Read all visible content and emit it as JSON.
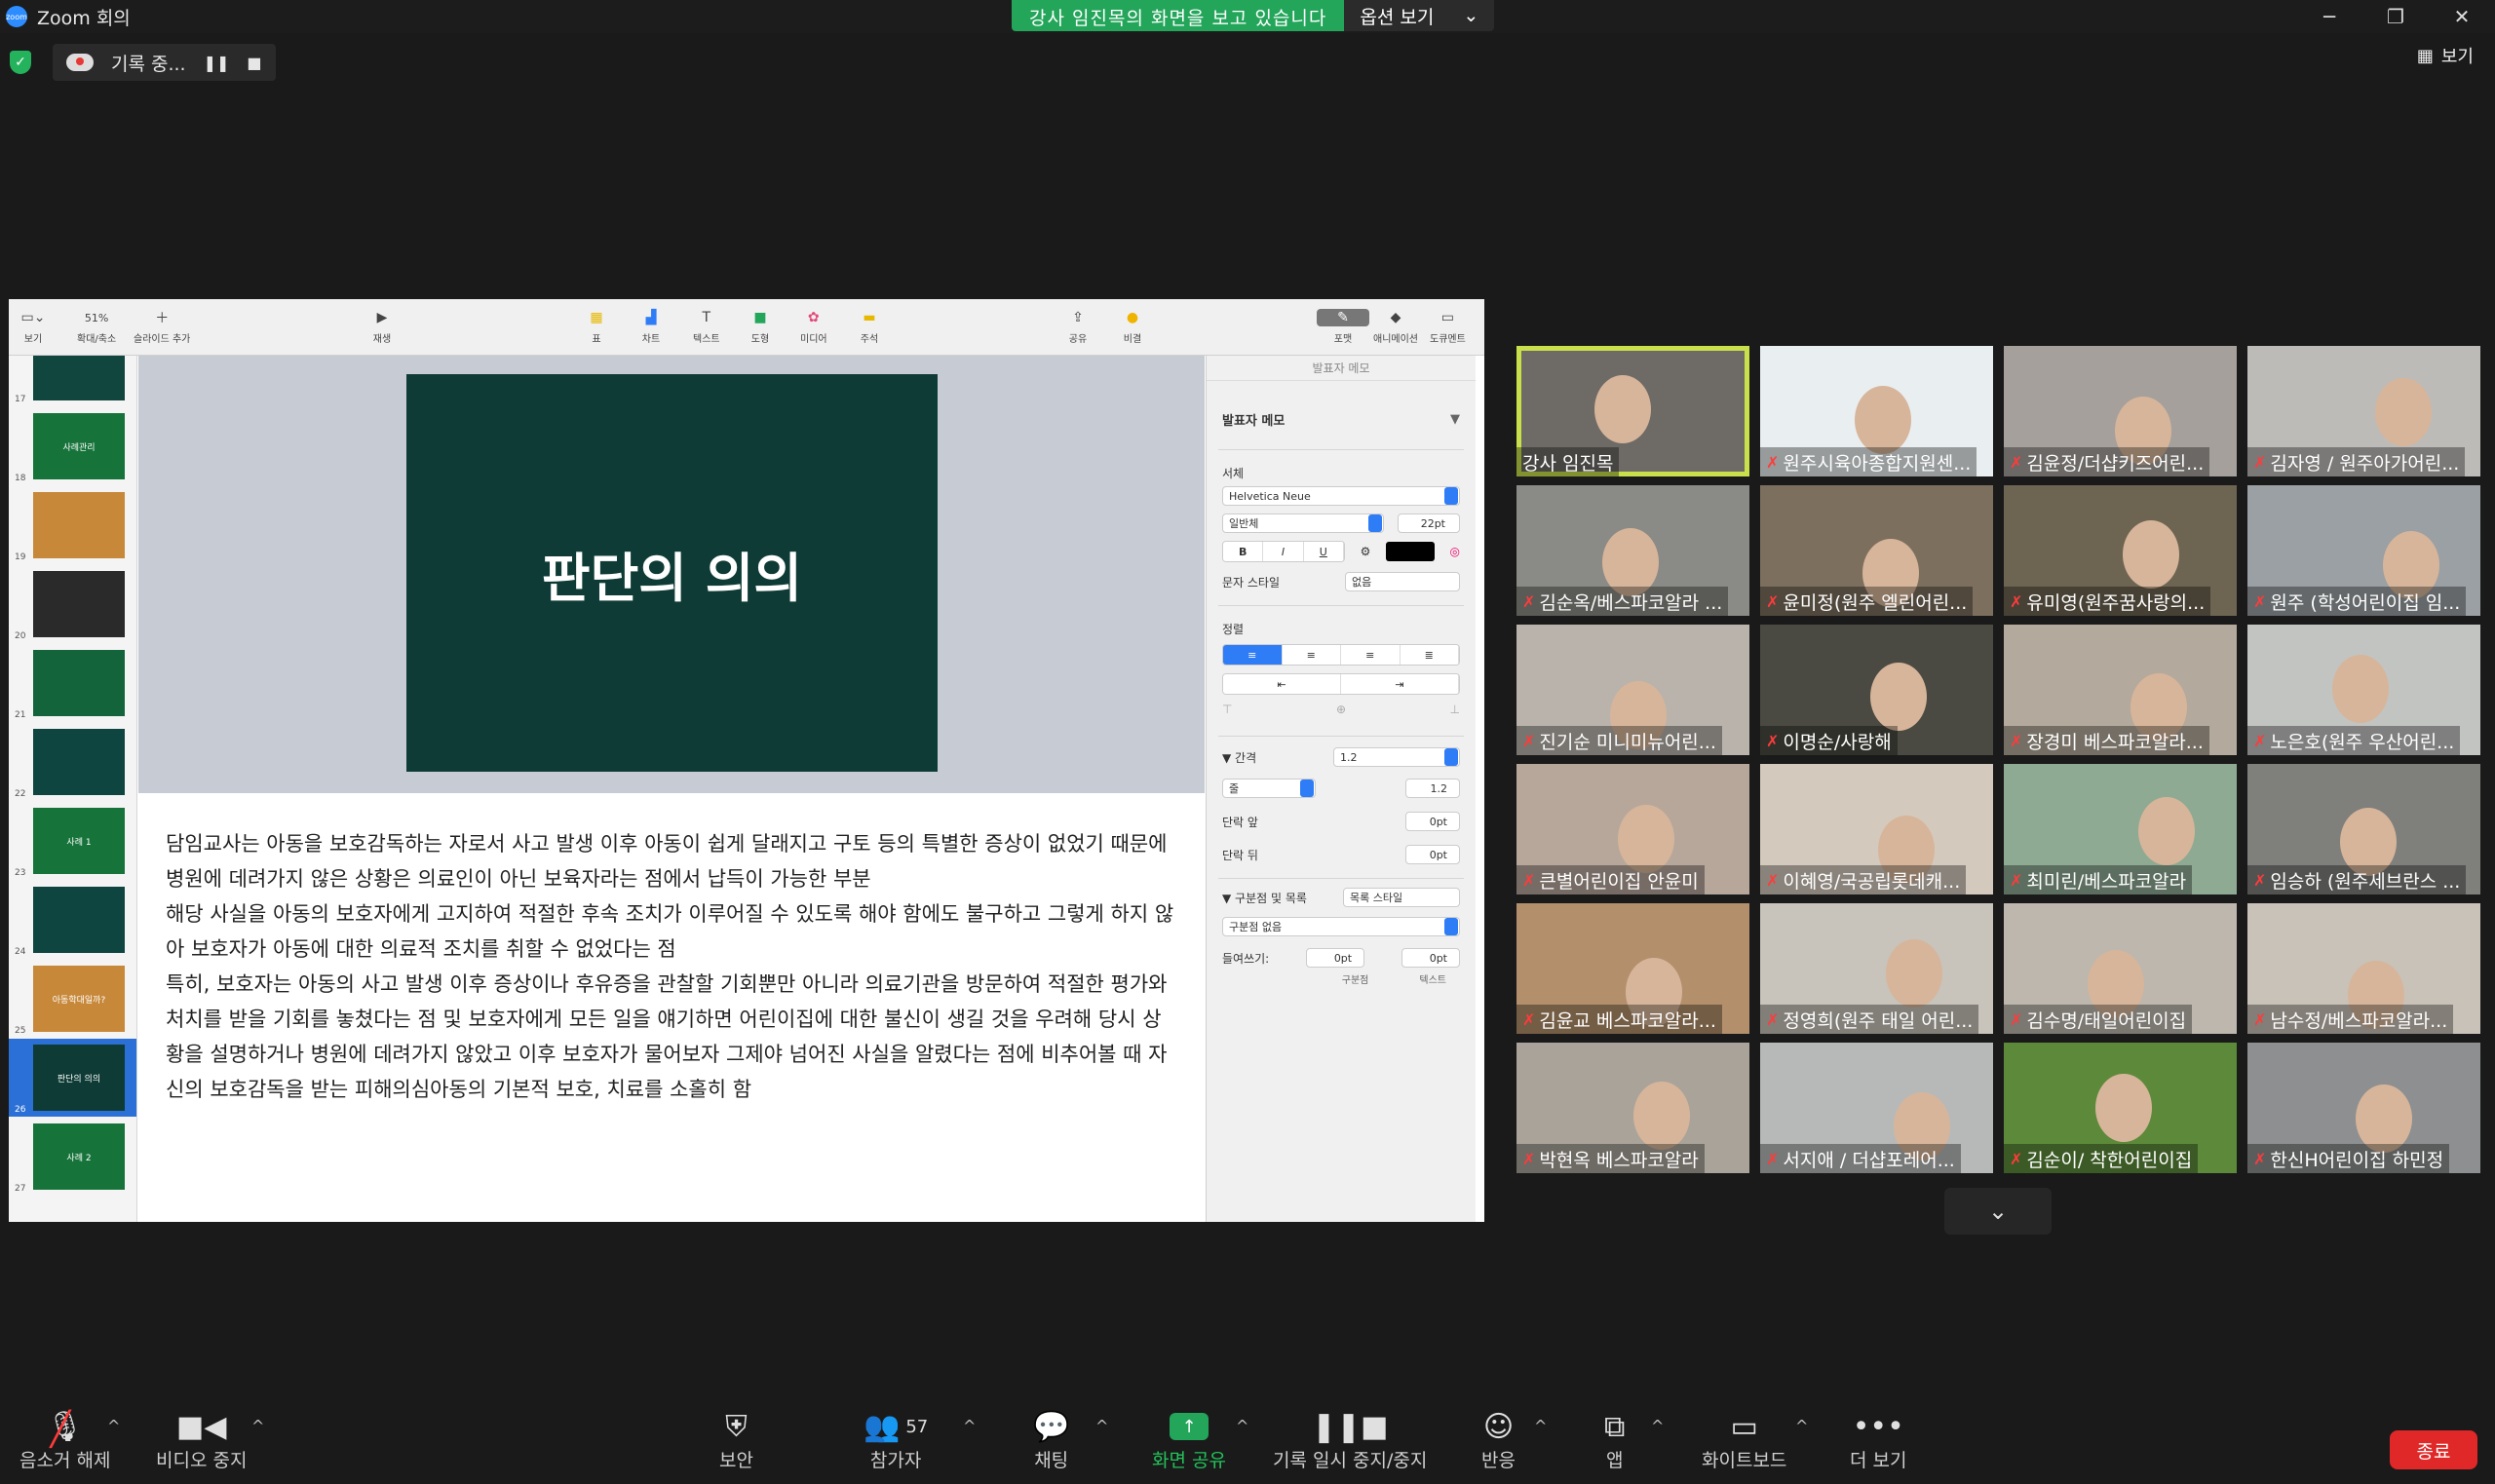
{
  "window": {
    "title": "Zoom 회의",
    "logo": "zoom"
  },
  "share_banner": {
    "text": "강사 임진목의 화면을 보고 있습니다",
    "options_label": "옵션 보기"
  },
  "recording": {
    "label": "기록 중..."
  },
  "top_right": {
    "view_label": "보기"
  },
  "keynote": {
    "toolbar": {
      "view": "보기",
      "zoom_value": "51%",
      "zoom": "확대/축소",
      "add_slide": "슬라이드 추가",
      "play": "재생",
      "table": "표",
      "chart": "차트",
      "text": "텍스트",
      "shape": "도형",
      "media": "미디어",
      "comment": "주석",
      "share": "공유",
      "tips": "비결",
      "format": "포맷",
      "animate": "애니메이션",
      "document": "도큐멘트"
    },
    "navigator": [
      {
        "num": "17",
        "title": "",
        "color": "#10463e"
      },
      {
        "num": "18",
        "title": "사례관리",
        "color": "#16733a"
      },
      {
        "num": "19",
        "title": "",
        "color": "#c7883a"
      },
      {
        "num": "20",
        "title": "",
        "color": "#2a2a2a"
      },
      {
        "num": "21",
        "title": "",
        "color": "#13643a"
      },
      {
        "num": "22",
        "title": "",
        "color": "#0f4540"
      },
      {
        "num": "23",
        "title": "사례 1",
        "color": "#16733a"
      },
      {
        "num": "24",
        "title": "",
        "color": "#0f4540"
      },
      {
        "num": "25",
        "title": "아동학대일까?",
        "color": "#c7883a"
      },
      {
        "num": "26",
        "title": "판단의 의의",
        "color": "#0e3b35"
      },
      {
        "num": "27",
        "title": "사례 2",
        "color": "#16733a"
      }
    ],
    "slide_title": "판단의 의의",
    "notes": [
      "담임교사는 아동을 보호감독하는 자로서 사고 발생 이후 아동이 쉽게 달래지고 구토 등의 특별한 증상이 없었기 때문에 병원에 데려가지 않은 상황은 의료인이 아닌 보육자라는 점에서 납득이 가능한 부분",
      "해당 사실을 아동의 보호자에게 고지하여 적절한 후속 조치가 이루어질 수 있도록 해야 함에도 불구하고 그렇게 하지 않아 보호자가 아동에 대한 의료적 조치를 취할 수 없었다는 점",
      "특히, 보호자는 아동의 사고 발생 이후 증상이나 후유증을 관찰할 기회뿐만 아니라 의료기관을 방문하여 적절한 평가와 처치를 받을 기회를 놓쳤다는 점 및 보호자에게 모든 일을 얘기하면 어린이집에 대한 불신이 생길 것을 우려해 당시 상황을 설명하거나 병원에 데려가지 않았고 이후 보호자가 물어보자 그제야 넘어진 사실을 알렸다는 점에 비추어볼 때 자신의 보호감독을 받는 피해의심아동의 기본적 보호, 치료를 소홀히 함"
    ],
    "inspector": {
      "tab": "발표자 메모",
      "style_title": "발표자 메모",
      "font_label": "서체",
      "font_name": "Helvetica Neue",
      "font_style": "일반체",
      "font_size": "22pt",
      "bold": "B",
      "italic": "I",
      "underline": "U",
      "char_style_label": "문자 스타일",
      "char_style_value": "없음",
      "align_label": "정렬",
      "spacing_label": "간격",
      "spacing_value": "1.2",
      "spacing_mode": "줄",
      "spacing_num": "1.2",
      "before_label": "단락 앞",
      "before_value": "0pt",
      "after_label": "단락 뒤",
      "after_value": "0pt",
      "bullets_label": "구분점 및 목록",
      "bullets_style": "목록 스타일",
      "bullets_value": "구분점 없음",
      "indent_label": "들여쓰기:",
      "indent_bullet": "0pt",
      "indent_text": "0pt",
      "indent_bullet_label": "구분점",
      "indent_text_label": "텍스트"
    }
  },
  "participants": [
    {
      "name": "강사 임진목",
      "muted": false,
      "bg": "#6e6a66",
      "active": true
    },
    {
      "name": "원주시육아종합지원센...",
      "muted": true,
      "bg": "#e9eef0"
    },
    {
      "name": "김윤정/더샵키즈어린...",
      "muted": true,
      "bg": "#a5a09b"
    },
    {
      "name": "김자영 / 원주아가어린...",
      "muted": true,
      "bg": "#bdbbb8"
    },
    {
      "name": "김순옥/베스파코알라 ...",
      "muted": true,
      "bg": "#8a8a86"
    },
    {
      "name": "윤미정(원주 엘린어린...",
      "muted": true,
      "bg": "#7c6f5e"
    },
    {
      "name": "유미영(원주꿈사랑의...",
      "muted": true,
      "bg": "#6d6552"
    },
    {
      "name": "원주 (학성어린이집 임...",
      "muted": true,
      "bg": "#9aa0a3"
    },
    {
      "name": "진기순 미니미뉴어린...",
      "muted": true,
      "bg": "#b9b3ab"
    },
    {
      "name": "이명순/사랑해",
      "muted": true,
      "bg": "#4a4a42"
    },
    {
      "name": "장경미 베스파코알라...",
      "muted": true,
      "bg": "#b3a99c"
    },
    {
      "name": "노은호(원주 우산어린...",
      "muted": true,
      "bg": "#c2c4c2"
    },
    {
      "name": "큰별어린이집 안윤미",
      "muted": true,
      "bg": "#b7a79b"
    },
    {
      "name": "이혜영/국공립롯데캐...",
      "muted": true,
      "bg": "#d4c9bd"
    },
    {
      "name": "최미린/베스파코알라",
      "muted": true,
      "bg": "#8eaa93"
    },
    {
      "name": "임승하 (원주세브란스 ...",
      "muted": true,
      "bg": "#7f7f7c"
    },
    {
      "name": "김윤교 베스파코알라...",
      "muted": true,
      "bg": "#b38f6b"
    },
    {
      "name": "정영희(원주 태일 어린...",
      "muted": true,
      "bg": "#c8c3bb"
    },
    {
      "name": "김수명/태일어린이집",
      "muted": true,
      "bg": "#bdb7ae"
    },
    {
      "name": "남수정/베스파코알라...",
      "muted": true,
      "bg": "#c9c2b8"
    },
    {
      "name": "박현옥 베스파코알라",
      "muted": true,
      "bg": "#aaa39a"
    },
    {
      "name": "서지애 / 더샵포레어...",
      "muted": true,
      "bg": "#b7b9b8"
    },
    {
      "name": "김순이/ 착한어린이집",
      "muted": true,
      "bg": "#5c8a3a"
    },
    {
      "name": "한신H어린이집  하민정",
      "muted": true,
      "bg": "#8d8f90"
    }
  ],
  "bottom_bar": {
    "mute": "음소거 해제",
    "video": "비디오 중지",
    "security": "보안",
    "participants": "참가자",
    "participants_count": "57",
    "chat": "채팅",
    "share": "화면 공유",
    "record": "기록 일시 중지/중지",
    "reactions": "반응",
    "apps": "앱",
    "whiteboard": "화이트보드",
    "more": "더 보기",
    "end": "종료"
  },
  "colors": {
    "accent_green": "#23a55a",
    "end_red": "#e02828",
    "active_speaker": "#c9e04c",
    "slide_bg": "#0e3b35"
  }
}
